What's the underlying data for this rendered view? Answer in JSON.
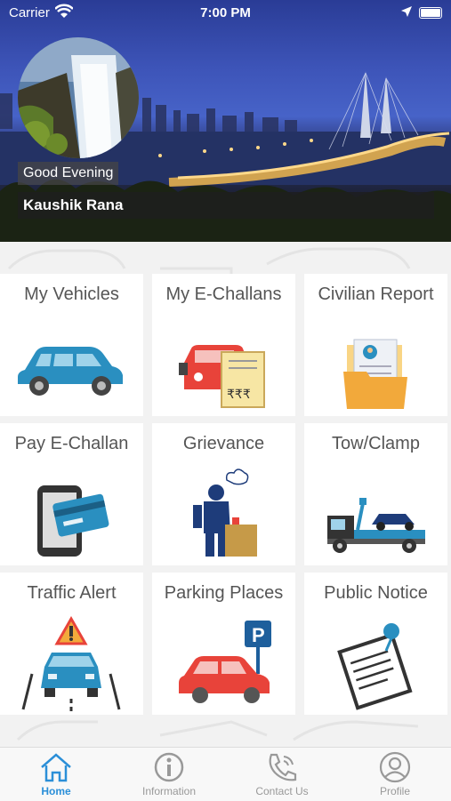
{
  "status_bar": {
    "carrier": "Carrier",
    "time": "7:00 PM"
  },
  "header": {
    "greeting": "Good Evening",
    "user_name": "Kaushik Rana"
  },
  "tiles": [
    {
      "label": "My Vehicles",
      "icon": "car-icon"
    },
    {
      "label": "My E-Challans",
      "icon": "challan-icon"
    },
    {
      "label": "Civilian Report",
      "icon": "report-folder-icon"
    },
    {
      "label": "Pay E-Challan",
      "icon": "phone-card-icon"
    },
    {
      "label": "Grievance",
      "icon": "grievance-person-icon"
    },
    {
      "label": "Tow/Clamp",
      "icon": "tow-truck-icon"
    },
    {
      "label": "Traffic Alert",
      "icon": "traffic-alert-icon"
    },
    {
      "label": "Parking Places",
      "icon": "parking-icon"
    },
    {
      "label": "Public Notice",
      "icon": "notice-icon"
    }
  ],
  "parking_sign": "P",
  "currency_glyphs": "₹₹₹",
  "tabs": [
    {
      "label": "Home",
      "icon": "home-icon",
      "active": true
    },
    {
      "label": "Information",
      "icon": "info-icon",
      "active": false
    },
    {
      "label": "Contact Us",
      "icon": "phone-icon",
      "active": false
    },
    {
      "label": "Profile",
      "icon": "profile-icon",
      "active": false
    }
  ],
  "colors": {
    "accent": "#2b8fd8",
    "tile_text": "#555555",
    "car_blue": "#2a8fc0",
    "car_red": "#e8433a"
  }
}
